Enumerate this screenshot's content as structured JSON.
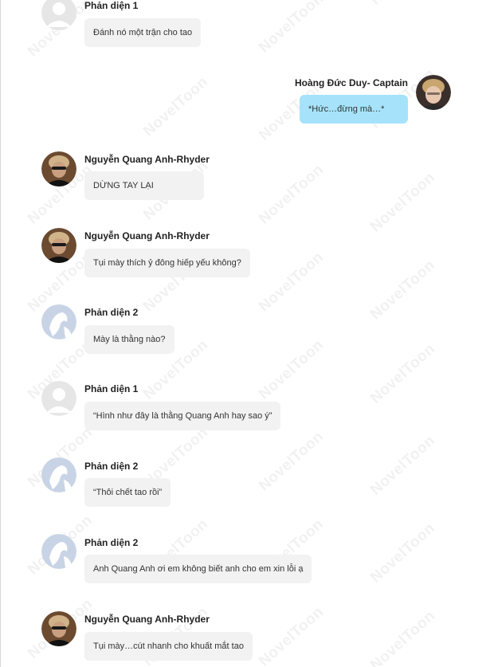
{
  "watermark": "NovelToon",
  "messages": [
    {
      "sender": "Phản diện 1",
      "text": "Đánh nó một trận cho tao",
      "avatar": "default-avatar-icon"
    },
    {
      "sender": "Hoàng Đức Duy- Captain",
      "text": "*Hức…đừng mà…*",
      "avatar": "user-photo-avatar"
    },
    {
      "sender": "Nguyễn Quang Anh-Rhyder",
      "text": "DỪNG TAY LẠI",
      "avatar": "rhyder-photo-avatar"
    },
    {
      "sender": "Nguyễn Quang Anh-Rhyder",
      "text": "Tụi mày thích ỷ đông hiếp yếu không?",
      "avatar": "rhyder-photo-avatar"
    },
    {
      "sender": "Phản diện 2",
      "text": "Mày là thằng nào?",
      "avatar": "anime-silhouette-avatar"
    },
    {
      "sender": "Phản diện 1",
      "text": "“Hình như đây là thằng Quang Anh hay sao ý”",
      "avatar": "default-avatar-icon"
    },
    {
      "sender": "Phản diện 2",
      "text": "“Thôi chết tao rồi”",
      "avatar": "anime-silhouette-avatar"
    },
    {
      "sender": "Phản diện 2",
      "text": "Anh Quang Anh ơi em không biết anh cho em xin lỗi ạ",
      "avatar": "anime-silhouette-avatar"
    },
    {
      "sender": "Nguyễn Quang Anh-Rhyder",
      "text": "Tụi mày…cút nhanh cho khuất mắt tao",
      "avatar": "rhyder-photo-avatar"
    }
  ],
  "colors": {
    "bubble_default": "#f2f2f2",
    "bubble_self": "#a6e3fb",
    "name_text": "#222222"
  }
}
